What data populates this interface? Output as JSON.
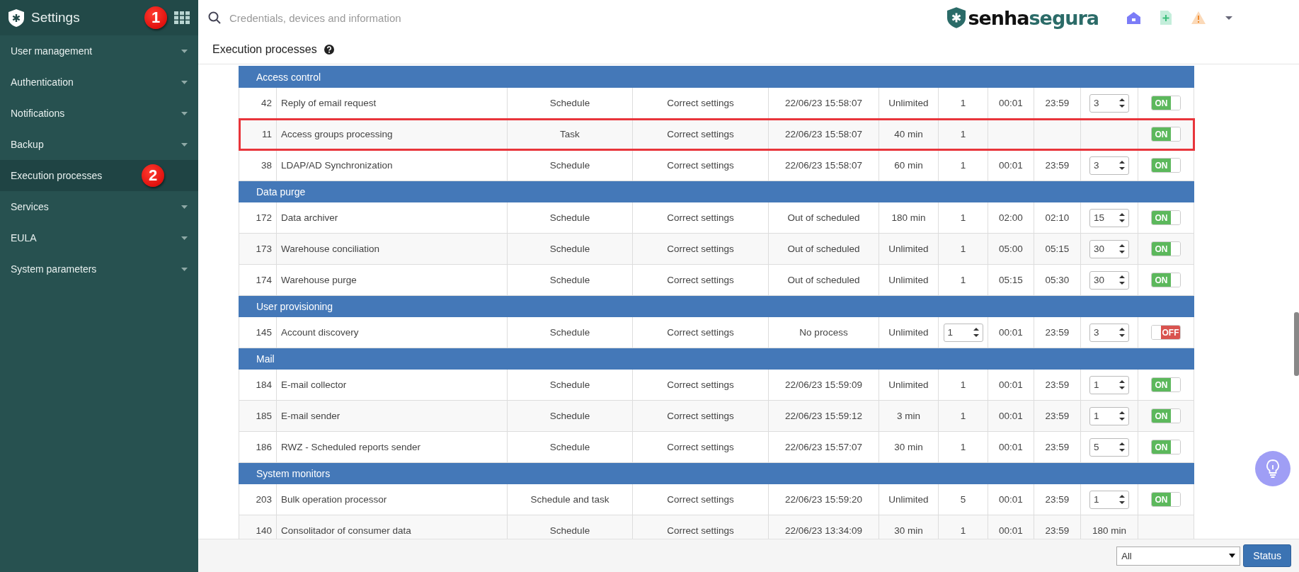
{
  "sidebar": {
    "title": "Settings",
    "callout": "1",
    "items": [
      {
        "label": "User management",
        "selected": false,
        "expandable": true
      },
      {
        "label": "Authentication",
        "selected": false,
        "expandable": true
      },
      {
        "label": "Notifications",
        "selected": false,
        "expandable": true
      },
      {
        "label": "Backup",
        "selected": false,
        "expandable": true
      },
      {
        "label": "Execution processes",
        "selected": true,
        "expandable": false,
        "callout": "2"
      },
      {
        "label": "Services",
        "selected": false,
        "expandable": true
      },
      {
        "label": "EULA",
        "selected": false,
        "expandable": true
      },
      {
        "label": "System parameters",
        "selected": false,
        "expandable": true
      }
    ]
  },
  "topbar": {
    "search": {
      "placeholder": "Credentials, devices and information"
    },
    "logo": {
      "parts": [
        "senha",
        "segura"
      ]
    }
  },
  "page": {
    "title": "Execution processes"
  },
  "groups": [
    {
      "title": "Access control",
      "rows": [
        {
          "id": "42",
          "name": "Reply of email request",
          "type": "Schedule",
          "status": "Correct settings",
          "last_run": "22/06/23 15:58:07",
          "limit": "Unlimited",
          "instances": {
            "kind": "text",
            "value": "1"
          },
          "start": "00:01",
          "end": "23:59",
          "interval": {
            "kind": "spinner",
            "value": "3"
          },
          "toggle": {
            "on": true,
            "label": "ON"
          },
          "highlighted": false
        },
        {
          "id": "11",
          "name": "Access groups processing",
          "type": "Task",
          "status": "Correct settings",
          "last_run": "22/06/23 15:58:07",
          "limit": "40 min",
          "instances": {
            "kind": "text",
            "value": "1"
          },
          "toggle": {
            "on": true,
            "label": "ON"
          },
          "highlighted": true
        },
        {
          "id": "38",
          "name": "LDAP/AD Synchronization",
          "type": "Schedule",
          "status": "Correct settings",
          "last_run": "22/06/23 15:58:07",
          "limit": "60 min",
          "instances": {
            "kind": "text",
            "value": "1"
          },
          "start": "00:01",
          "end": "23:59",
          "interval": {
            "kind": "spinner",
            "value": "3"
          },
          "toggle": {
            "on": true,
            "label": "ON"
          },
          "highlighted": false
        }
      ]
    },
    {
      "title": "Data purge",
      "rows": [
        {
          "id": "172",
          "name": "Data archiver",
          "type": "Schedule",
          "status": "Correct settings",
          "last_run": "Out of scheduled",
          "limit": "180 min",
          "instances": {
            "kind": "text",
            "value": "1"
          },
          "start": "02:00",
          "end": "02:10",
          "interval": {
            "kind": "spinner",
            "value": "15"
          },
          "toggle": {
            "on": true,
            "label": "ON"
          },
          "highlighted": false
        },
        {
          "id": "173",
          "name": "Warehouse conciliation",
          "type": "Schedule",
          "status": "Correct settings",
          "last_run": "Out of scheduled",
          "limit": "Unlimited",
          "instances": {
            "kind": "text",
            "value": "1"
          },
          "start": "05:00",
          "end": "05:15",
          "interval": {
            "kind": "spinner",
            "value": "30"
          },
          "toggle": {
            "on": true,
            "label": "ON"
          },
          "highlighted": false
        },
        {
          "id": "174",
          "name": "Warehouse purge",
          "type": "Schedule",
          "status": "Correct settings",
          "last_run": "Out of scheduled",
          "limit": "Unlimited",
          "instances": {
            "kind": "text",
            "value": "1"
          },
          "start": "05:15",
          "end": "05:30",
          "interval": {
            "kind": "spinner",
            "value": "30"
          },
          "toggle": {
            "on": true,
            "label": "ON"
          },
          "highlighted": false
        }
      ]
    },
    {
      "title": "User provisioning",
      "rows": [
        {
          "id": "145",
          "name": "Account discovery",
          "type": "Schedule",
          "status": "Correct settings",
          "last_run": "No process",
          "limit": "Unlimited",
          "instances": {
            "kind": "spinner",
            "value": "1"
          },
          "start": "00:01",
          "end": "23:59",
          "interval": {
            "kind": "spinner",
            "value": "3"
          },
          "toggle": {
            "on": false,
            "label": "OFF"
          },
          "highlighted": false
        }
      ]
    },
    {
      "title": "Mail",
      "rows": [
        {
          "id": "184",
          "name": "E-mail collector",
          "type": "Schedule",
          "status": "Correct settings",
          "last_run": "22/06/23 15:59:09",
          "limit": "Unlimited",
          "instances": {
            "kind": "text",
            "value": "1"
          },
          "start": "00:01",
          "end": "23:59",
          "interval": {
            "kind": "spinner",
            "value": "1"
          },
          "toggle": {
            "on": true,
            "label": "ON"
          },
          "highlighted": false
        },
        {
          "id": "185",
          "name": "E-mail sender",
          "type": "Schedule",
          "status": "Correct settings",
          "last_run": "22/06/23 15:59:12",
          "limit": "3 min",
          "instances": {
            "kind": "text",
            "value": "1"
          },
          "start": "00:01",
          "end": "23:59",
          "interval": {
            "kind": "spinner",
            "value": "1"
          },
          "toggle": {
            "on": true,
            "label": "ON"
          },
          "highlighted": false
        },
        {
          "id": "186",
          "name": "RWZ - Scheduled reports sender",
          "type": "Schedule",
          "status": "Correct settings",
          "last_run": "22/06/23 15:57:07",
          "limit": "30 min",
          "instances": {
            "kind": "text",
            "value": "1"
          },
          "start": "00:01",
          "end": "23:59",
          "interval": {
            "kind": "spinner",
            "value": "5"
          },
          "toggle": {
            "on": true,
            "label": "ON"
          },
          "highlighted": false
        }
      ]
    },
    {
      "title": "System monitors",
      "rows": [
        {
          "id": "203",
          "name": "Bulk operation processor",
          "type": "Schedule and task",
          "status": "Correct settings",
          "last_run": "22/06/23 15:59:20",
          "limit": "Unlimited",
          "instances": {
            "kind": "text",
            "value": "5"
          },
          "start": "00:01",
          "end": "23:59",
          "interval": {
            "kind": "spinner",
            "value": "1"
          },
          "toggle": {
            "on": true,
            "label": "ON"
          },
          "highlighted": false
        },
        {
          "id": "140",
          "name": "Consolitador of consumer data",
          "type": "Schedule",
          "status": "Correct settings",
          "last_run": "22/06/23 13:34:09",
          "limit": "30 min",
          "instances": {
            "kind": "text",
            "value": "1"
          },
          "start": "00:01",
          "end": "23:59",
          "interval": {
            "kind": "text",
            "value": "180 min"
          },
          "highlighted": false
        }
      ]
    }
  ],
  "footer": {
    "filter": {
      "value": "All"
    },
    "button": "Status"
  }
}
